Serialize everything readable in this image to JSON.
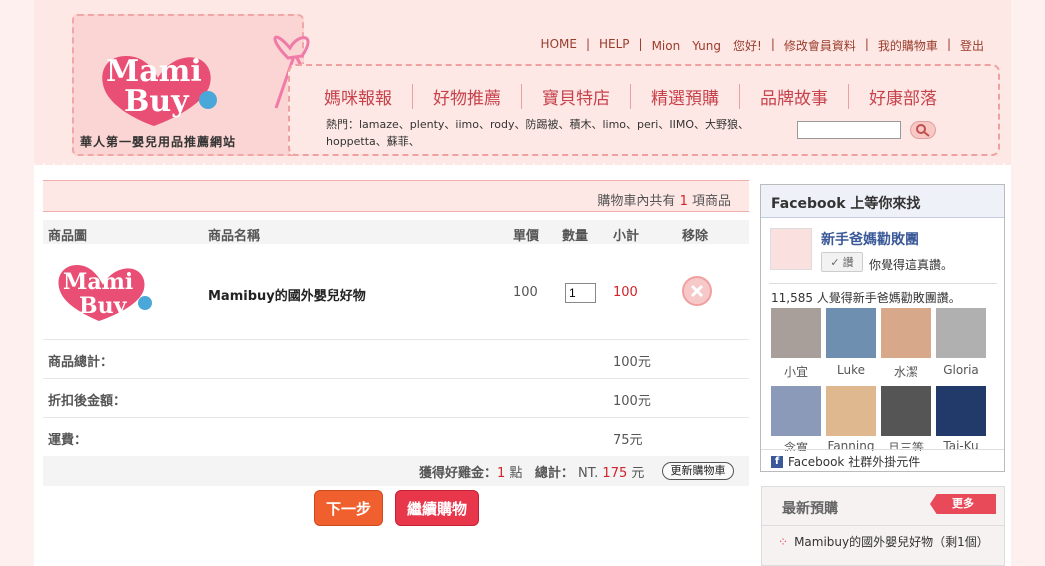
{
  "header": {
    "logo_line1": "Mami",
    "logo_line2": "Buy",
    "tagline": "華人第一嬰兒用品推薦網站",
    "top_links": [
      "HOME",
      "HELP",
      "Mion　Yung　您好!",
      "修改會員資料",
      "我的購物車",
      "登出"
    ],
    "nav": [
      "媽咪報報",
      "好物推薦",
      "寶貝特店",
      "精選預購",
      "品牌故事",
      "好康部落"
    ],
    "hot_text": "熱門：lamaze、plenty、iimo、rody、防踢被、積木、limo、peri、IIMO、大野狼、hoppetta、蘇菲、",
    "search_placeholder": ""
  },
  "cart": {
    "summary_prefix": "購物車內共有",
    "summary_count": "1",
    "summary_suffix": "項商品",
    "columns": [
      "商品圖",
      "商品名稱",
      "單價",
      "數量",
      "小計",
      "移除"
    ],
    "item": {
      "name": "Mamibuy的國外嬰兒好物",
      "price": "100",
      "quantity": "1",
      "subtotal": "100"
    },
    "rows": [
      {
        "label": "商品總計：",
        "value": "100元"
      },
      {
        "label": "折扣後金額：",
        "value": "100元"
      },
      {
        "label": "運費：",
        "value": "75元"
      }
    ],
    "points_label": "獲得好雞金：",
    "points_value": "1",
    "points_unit": "點",
    "total_label": "總計：",
    "total_prefix": "NT.",
    "total_value": "175",
    "total_unit": "元",
    "update_button": "更新購物車",
    "next_button": "下一步",
    "continue_button": "繼續購物"
  },
  "facebook": {
    "title": "Facebook 上等你來找",
    "page_name": "新手爸媽勸敗團",
    "like_button": "讚",
    "like_text": "你覺得這真讚。",
    "count_text": "11,585 人覺得新手爸媽勸敗團讚。",
    "fans": [
      "小宜",
      "Luke",
      "水潔",
      "Gloria"
    ],
    "fans_row2": [
      "念寬",
      "Fanning",
      "旦三等",
      "Tai-Ku"
    ],
    "footer": "Facebook 社群外掛元件",
    "colors": {
      "brand": "#3b5998"
    }
  },
  "latest": {
    "title": "最新預購",
    "more_button": "更多",
    "item": "Mamibuy的國外嬰兒好物（剩1個）"
  },
  "colors": {
    "accent": "#d0232b",
    "pink_bg": "#fde8e5",
    "button_orange": "#f05a2a",
    "button_red": "#e8364a"
  }
}
